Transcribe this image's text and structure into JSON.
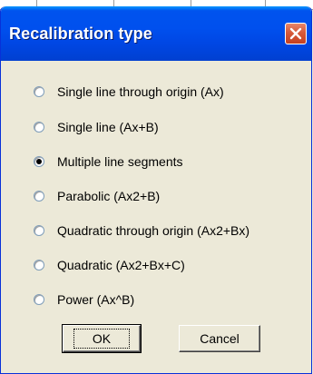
{
  "dialog": {
    "title": "Recalibration type",
    "close_icon": "close-icon"
  },
  "options": [
    {
      "label": "Single line through origin (Ax)",
      "checked": false
    },
    {
      "label": "Single line (Ax+B)",
      "checked": false
    },
    {
      "label": "Multiple line segments",
      "checked": true
    },
    {
      "label": "Parabolic (Ax2+B)",
      "checked": false
    },
    {
      "label": "Quadratic through origin (Ax2+Bx)",
      "checked": false
    },
    {
      "label": "Quadratic (Ax2+Bx+C)",
      "checked": false
    },
    {
      "label": "Power (Ax^B)",
      "checked": false
    }
  ],
  "buttons": {
    "ok_label": "OK",
    "cancel_label": "Cancel"
  },
  "colors": {
    "title_bar": "#0050ee",
    "close_button": "#d65a3a",
    "dialog_bg": "#ece9d8"
  }
}
